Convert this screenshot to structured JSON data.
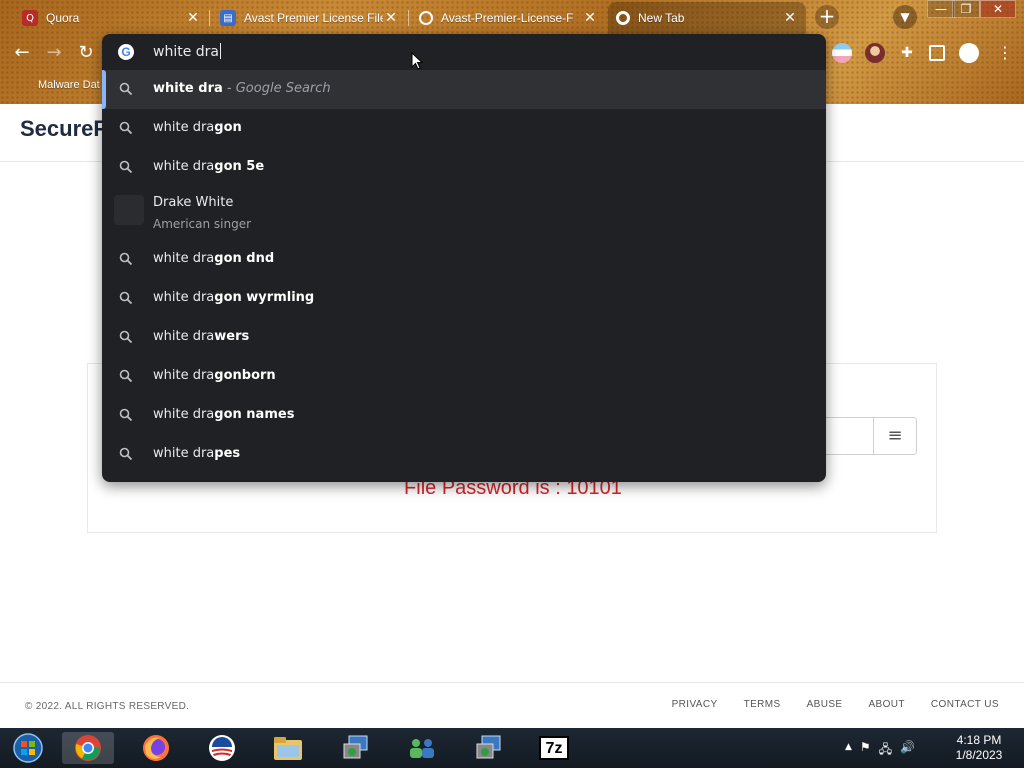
{
  "browser": {
    "tabs": [
      {
        "title": "Quora",
        "favicon": "quora-icon",
        "favicon_color": "#b92b27"
      },
      {
        "title": "Avast Premier License File",
        "favicon": "document-icon",
        "favicon_color": "#3b6cc7"
      },
      {
        "title": "Avast-Premier-License-F",
        "favicon": "globe-icon",
        "favicon_color": "#ffffff"
      },
      {
        "title": "New Tab",
        "favicon": "chrome-icon",
        "favicon_color": "#ffffff"
      }
    ],
    "close_glyph": "✕",
    "newtab_glyph": "+",
    "window_controls": {
      "minimize": "—",
      "restore": "❐",
      "close": "✕"
    },
    "nav": {
      "back": "←",
      "forward": "→",
      "reload": "↻"
    },
    "bookmark_label": "Malware Dat"
  },
  "omnibox": {
    "typed": "white dra",
    "suggestions": [
      {
        "typed": "white dra",
        "completion": "",
        "hint": " - Google Search"
      },
      {
        "typed": "white dra",
        "completion": "gon",
        "hint": ""
      },
      {
        "typed": "white dra",
        "completion": "gon 5e",
        "hint": ""
      },
      {
        "entity_title": "Drake White",
        "entity_subtitle": "American singer"
      },
      {
        "typed": "white dra",
        "completion": "gon dnd",
        "hint": ""
      },
      {
        "typed": "white dra",
        "completion": "gon wyrmling",
        "hint": ""
      },
      {
        "typed": "white dra",
        "completion": "wers",
        "hint": ""
      },
      {
        "typed": "white dra",
        "completion": "gonborn",
        "hint": ""
      },
      {
        "typed": "white dra",
        "completion": "gon names",
        "hint": ""
      },
      {
        "typed": "white dra",
        "completion": "pes",
        "hint": ""
      }
    ]
  },
  "page": {
    "brand": "SecureF",
    "menu_glyph": "≡",
    "password_text": "File Password is : 10101",
    "password_color": "#d8232a",
    "copyright": "© 2022. ALL RIGHTS RESERVED.",
    "footer_links": [
      "PRIVACY",
      "TERMS",
      "ABUSE",
      "ABOUT",
      "CONTACT US"
    ]
  },
  "taskbar": {
    "items": [
      "start-orb-icon",
      "chrome-icon",
      "firefox-icon",
      "obama-logo-icon",
      "file-explorer-icon",
      "installer-icon",
      "network-people-icon",
      "installer-icon",
      "7zip-icon"
    ],
    "zip_label": "7z",
    "time": "4:18 PM",
    "date": "1/8/2023"
  }
}
